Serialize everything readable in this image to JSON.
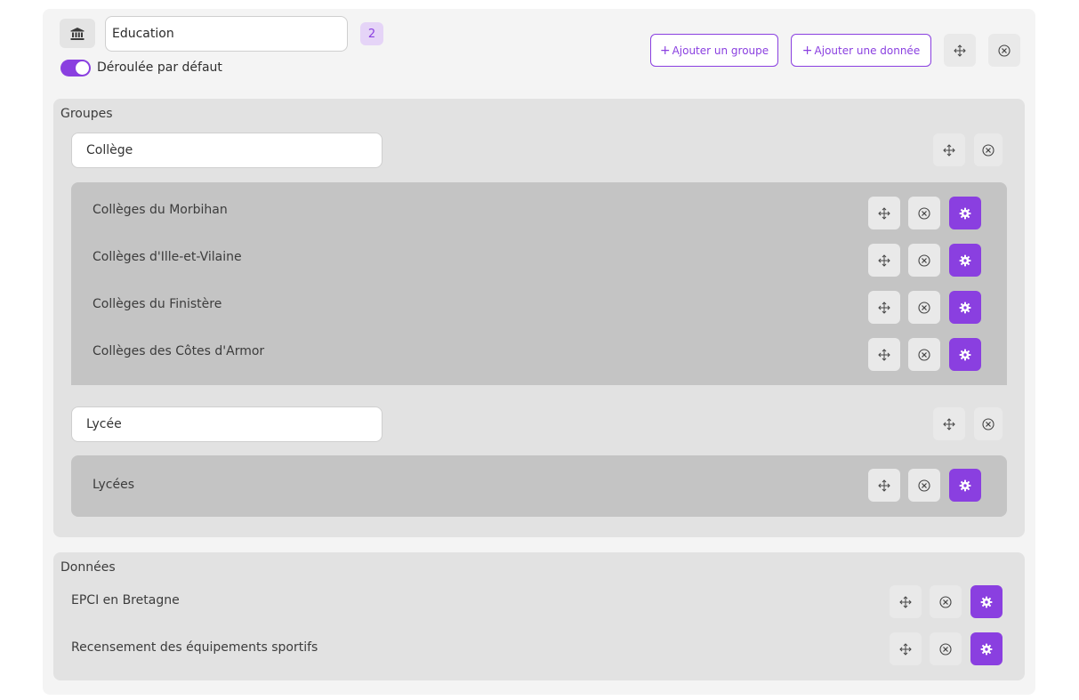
{
  "theme": {
    "name": "Education",
    "count": "2",
    "toggle_label": "Déroulée par défaut",
    "toggle_on": true,
    "add_group_label": "Ajouter un groupe",
    "add_data_label": "Ajouter une donnée",
    "plus_symbol": "+"
  },
  "groups_section": {
    "title": "Groupes",
    "groups": [
      {
        "name": "Collège",
        "items": [
          {
            "label": "Collèges du Morbihan"
          },
          {
            "label": "Collèges d'Ille-et-Vilaine"
          },
          {
            "label": "Collèges du Finistère"
          },
          {
            "label": "Collèges des Côtes d'Armor"
          }
        ]
      },
      {
        "name": "Lycée",
        "items": [
          {
            "label": "Lycées"
          }
        ]
      }
    ]
  },
  "data_section": {
    "title": "Données",
    "items": [
      {
        "label": "EPCI en Bretagne"
      },
      {
        "label": "Recensement des équipements sportifs"
      }
    ]
  },
  "colors": {
    "accent": "#8a3fe0",
    "badge_bg": "#e5d4f7",
    "panel_bg": "#f4f4f4",
    "section_bg": "#e2e2e2",
    "group_bg": "#c4c4c4"
  },
  "icons": {
    "theme": "building-columns-icon",
    "move": "move-arrows-icon",
    "remove": "circle-x-icon",
    "settings": "gear-icon"
  }
}
